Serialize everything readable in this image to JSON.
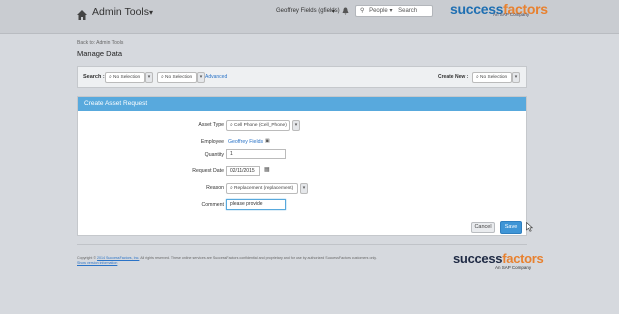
{
  "header": {
    "home_icon": "home-icon",
    "title": "Admin Tools",
    "user": "Geoffrey Fields (gfields)",
    "search_scope": "People",
    "search_placeholder": "Search",
    "logo_main": "success",
    "logo_accent": "factors",
    "logo_sub": "An SAP Company"
  },
  "breadcrumb": {
    "back": "Back to: Admin Tools",
    "title": "Manage Data"
  },
  "search_panel": {
    "label": "Search :",
    "select1": "No Selection",
    "select2": "No Selection",
    "advanced": "Advanced",
    "create_label": "Create New :",
    "create_select": "No Selection"
  },
  "dialog": {
    "title": "Create Asset Request",
    "fields": {
      "asset_type_label": "Asset Type",
      "asset_type_value": "Cell Phone (Cell_Phone)",
      "employee_label": "Employee",
      "employee_value": "Geoffrey Fields",
      "quantity_label": "Quantity",
      "quantity_value": "1",
      "request_date_label": "Request Date",
      "request_date_value": "02/11/2015",
      "reason_label": "Reason",
      "reason_value": "Replacement (replacement)",
      "comment_label": "Comment",
      "comment_value": "please provide"
    },
    "cancel": "Cancel",
    "save": "Save"
  },
  "footer": {
    "copyright_prefix": "Copyright ©",
    "copyright_link": "2014 SuccessFactors, Inc.",
    "copyright_rest": "All rights reserved. These online services are SuccessFactors confidential and proprietary and for use by authorized SuccessFactors customers only.",
    "version_link": "Show version information",
    "logo_main": "success",
    "logo_accent": "factors",
    "logo_sub": "An SAP Company"
  },
  "colors": {
    "accent": "#58a9dd",
    "save_button": "#3f95d6",
    "link": "#2a73c7",
    "logo_orange": "#e8812f"
  }
}
